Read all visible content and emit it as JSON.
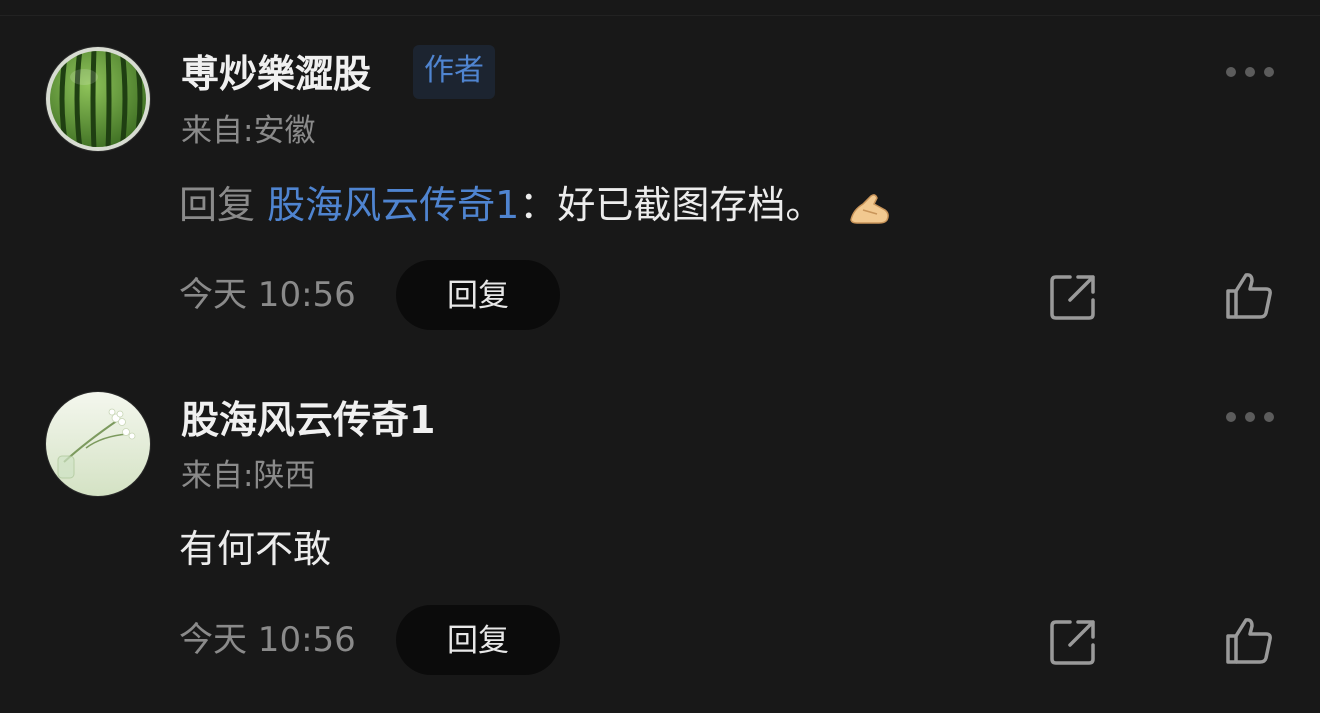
{
  "comments": [
    {
      "username": "尃炒樂澀股",
      "badge": "作者",
      "location": "来自:安徽",
      "reply_prefix": "回复",
      "mention": "股海风云传奇1",
      "separator": "：",
      "text": "好已截图存档。",
      "emoji_icon": "pinched-hand-emoji-icon",
      "time": "今天 10:56",
      "reply_label": "回复",
      "avatar_icon": "watermelon-avatar"
    },
    {
      "username": "股海风云传奇1",
      "location": "来自:陕西",
      "text": "有何不敢",
      "time": "今天 10:56",
      "reply_label": "回复",
      "avatar_icon": "flower-vase-avatar"
    }
  ],
  "icons": {
    "more": "more-dots-icon",
    "share": "share-icon",
    "like": "thumbs-up-icon"
  },
  "colors": {
    "background": "#181818",
    "mention": "#4f84d0",
    "badge_bg": "#1c2430",
    "secondary_text": "#8a8a8a",
    "reply_button_bg": "#0b0b0b",
    "icon": "#9a9a9a"
  }
}
